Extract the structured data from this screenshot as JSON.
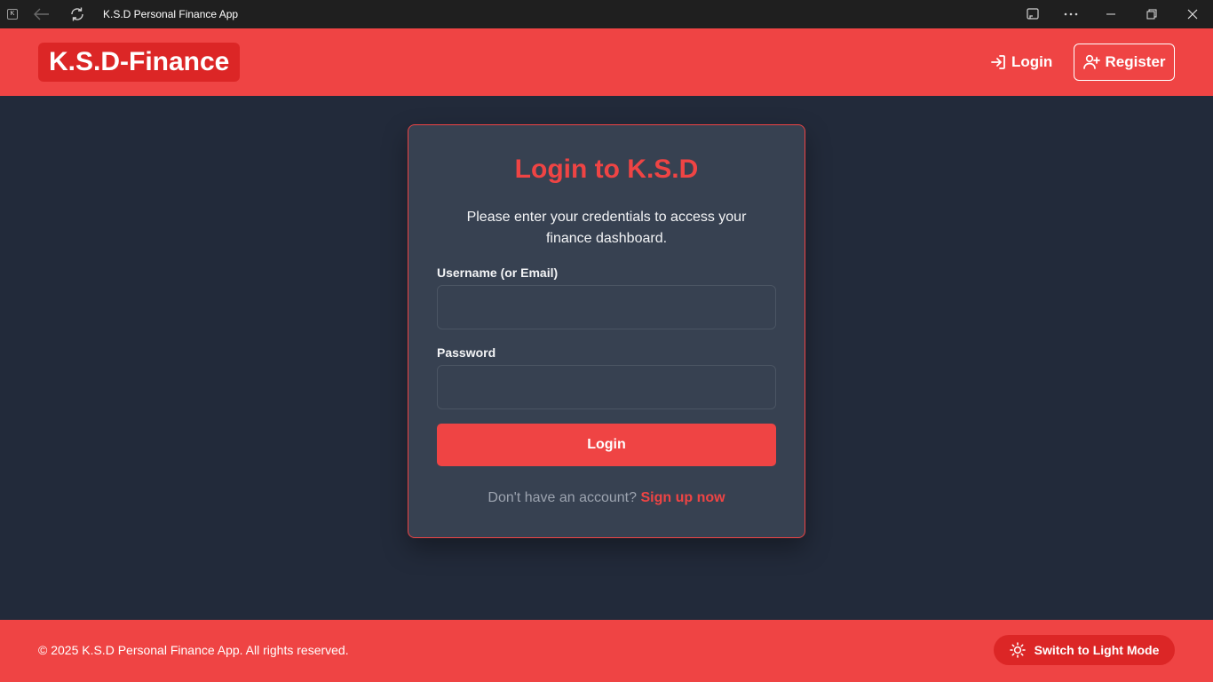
{
  "window": {
    "title": "K.S.D Personal Finance App",
    "app_icon_letter": "K"
  },
  "header": {
    "brand": "K.S.D-Finance",
    "nav": {
      "login_label": "Login",
      "register_label": "Register"
    }
  },
  "login_card": {
    "title": "Login to K.S.D",
    "subtitle": "Please enter your credentials to access your finance dashboard.",
    "username_label": "Username (or Email)",
    "username_value": "",
    "password_label": "Password",
    "password_value": "",
    "submit_label": "Login",
    "signup_prompt": "Don't have an account?",
    "signup_link": "Sign up now"
  },
  "footer": {
    "copyright": "© 2025 K.S.D Personal Finance App. All rights reserved.",
    "theme_toggle_label": "Switch to Light Mode"
  },
  "icons": {
    "back": "arrow-left-icon",
    "refresh": "refresh-icon",
    "cast": "cast-icon",
    "more": "more-icon",
    "minimize": "minimize-icon",
    "maximize": "maximize-icon",
    "close": "close-icon",
    "login": "login-icon",
    "register": "user-plus-icon",
    "theme": "sun-icon"
  },
  "colors": {
    "accent": "#ef4444",
    "accent_dark": "#dc2626",
    "background": "#222a3a",
    "card": "#374151"
  }
}
